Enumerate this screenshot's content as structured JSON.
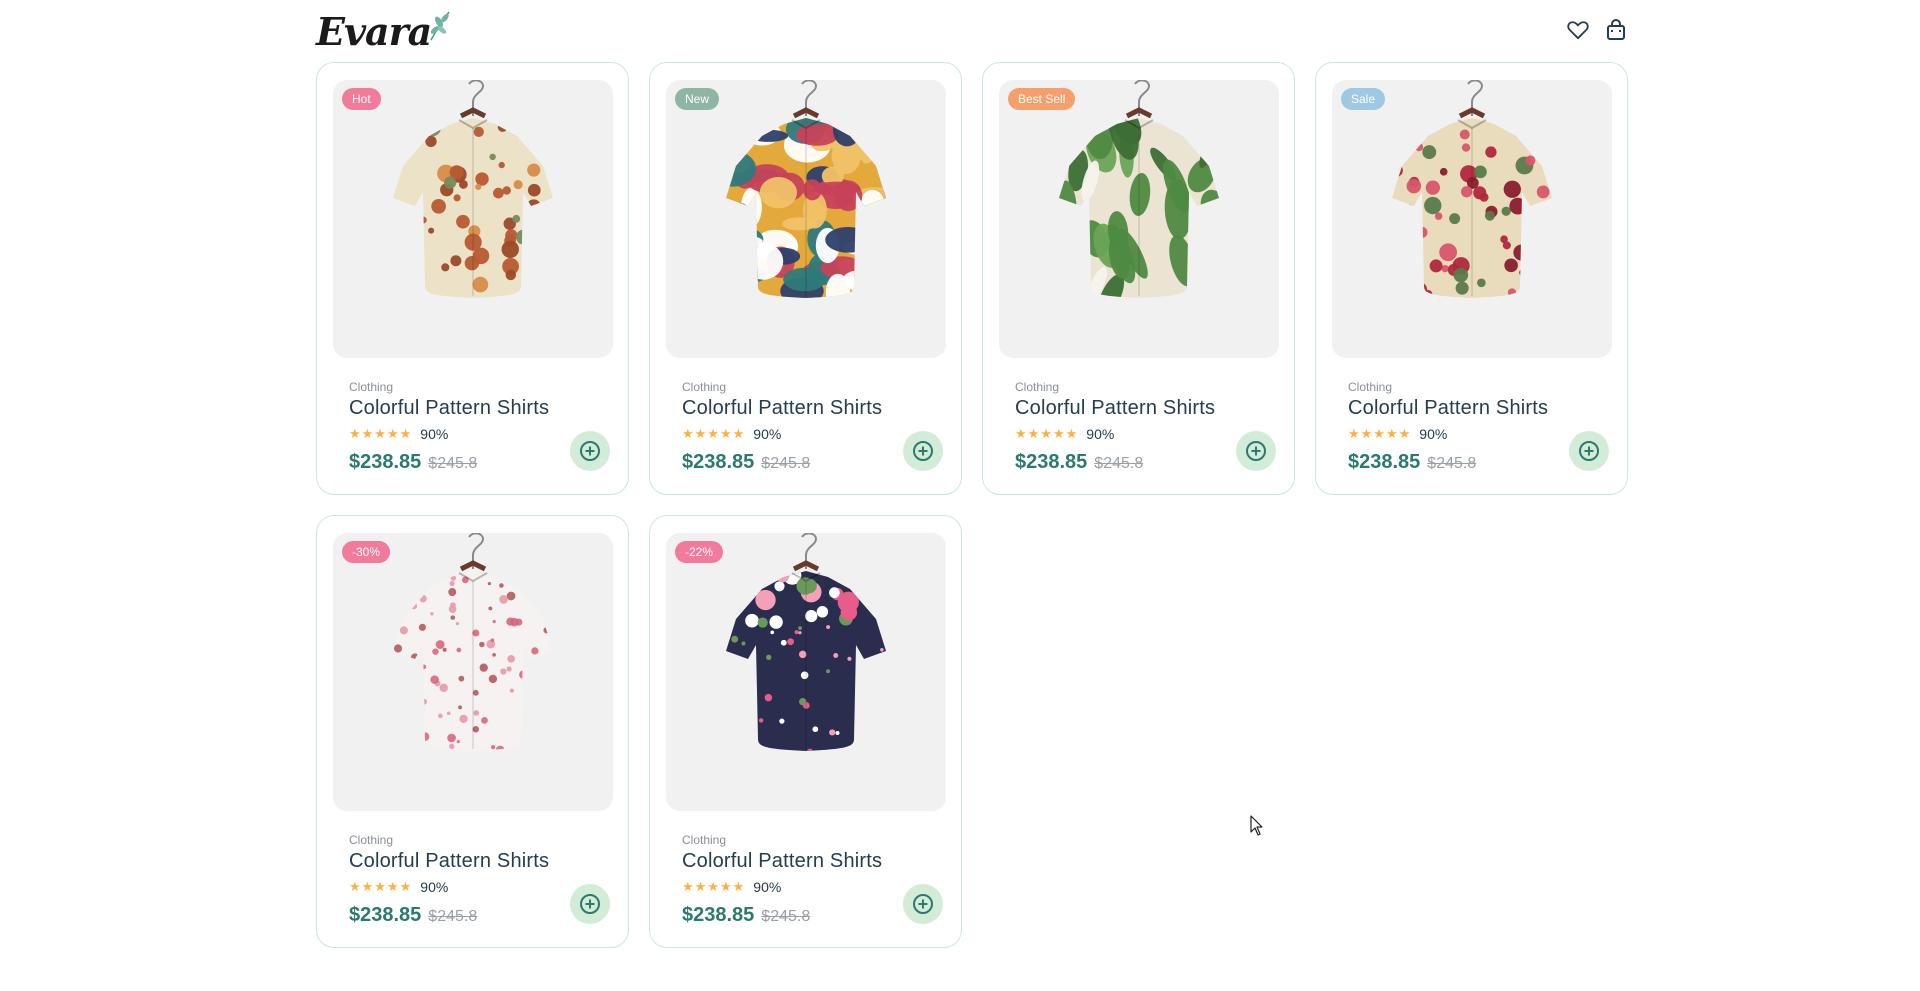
{
  "header": {
    "logo_text": "Evara",
    "wishlist_icon": "heart-icon",
    "cart_icon": "shopping-bag-icon"
  },
  "colors": {
    "accent": "#2a7a70",
    "add_button_bg": "#d2ecd8",
    "card_border": "#cde6e2",
    "star": "#fdb03c"
  },
  "products": [
    {
      "badge": "Hot",
      "badge_color": "#f27a9a",
      "category": "Clothing",
      "name": "Colorful Pattern Shirts",
      "stars": "★★★★★",
      "rating": "90%",
      "price": "$238.85",
      "old_price": "$245.8",
      "image": "mushroom-print-shirt"
    },
    {
      "badge": "New",
      "badge_color": "#8fb5a5",
      "category": "Clothing",
      "name": "Colorful Pattern Shirts",
      "stars": "★★★★★",
      "rating": "90%",
      "price": "$238.85",
      "old_price": "$245.8",
      "image": "abstract-bird-print-shirt"
    },
    {
      "badge": "Best Sell",
      "badge_color": "#f59f6b",
      "category": "Clothing",
      "name": "Colorful Pattern Shirts",
      "stars": "★★★★★",
      "rating": "90%",
      "price": "$238.85",
      "old_price": "$245.8",
      "image": "tropical-leaf-print-shirt"
    },
    {
      "badge": "Sale",
      "badge_color": "#9ec8e4",
      "category": "Clothing",
      "name": "Colorful Pattern Shirts",
      "stars": "★★★★★",
      "rating": "90%",
      "price": "$238.85",
      "old_price": "$245.8",
      "image": "rose-print-shirt"
    },
    {
      "badge": "-30%",
      "badge_color": "#f27a9a",
      "category": "Clothing",
      "name": "Colorful Pattern Shirts",
      "stars": "★★★★★",
      "rating": "90%",
      "price": "$238.85",
      "old_price": "$245.8",
      "image": "white-blossom-shirt"
    },
    {
      "badge": "-22%",
      "badge_color": "#f27a9a",
      "category": "Clothing",
      "name": "Colorful Pattern Shirts",
      "stars": "★★★★★",
      "rating": "90%",
      "price": "$238.85",
      "old_price": "$245.8",
      "image": "navy-floral-shirt"
    }
  ]
}
